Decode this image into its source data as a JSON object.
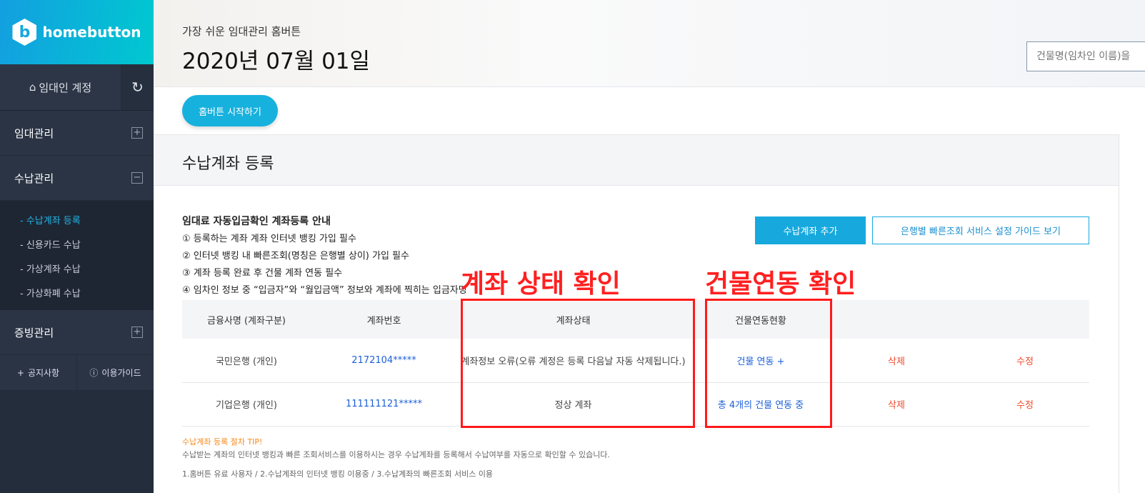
{
  "sidebar": {
    "logo": "homebutton",
    "account": "임대인 계정",
    "menu": [
      {
        "label": "임대관리",
        "toggle": "+"
      },
      {
        "label": "수납관리",
        "toggle": "−"
      },
      {
        "label": "증빙관리",
        "toggle": "+"
      }
    ],
    "sub": [
      "- 수납계좌 등록",
      "- 신용카드 수납",
      "- 가상계좌 수납",
      "- 가상화폐 수납"
    ],
    "notice": "공지사항",
    "guide": "이용가이드"
  },
  "header": {
    "subtitle": "가장 쉬운 임대관리 홈버튼",
    "date": "2020년 07월 01일",
    "search_placeholder": "건물명(임차인 이름)을"
  },
  "start_button": "홈버튼 시작하기",
  "section_title": "수납계좌 등록",
  "guide": {
    "title": "임대료 자동입금확인 계좌등록 안내",
    "items": [
      "① 등록하는 계좌 계좌 인터넷 뱅킹 가입 필수",
      "② 인터넷 뱅킹 내 빠른조회(명칭은 은행별 상이) 가입 필수",
      "③ 계좌 등록 완료 후 건물 계좌 연동 필수",
      "④ 임차인 정보 중 “입금자”와 “월입금액” 정보와 계좌에 찍히는 입금자명"
    ]
  },
  "buttons": {
    "add": "수납계좌 추가",
    "bank_guide": "은행별 빠른조회 서비스 설정 가이드 보기"
  },
  "table": {
    "headers": [
      "금융사명 (계좌구분)",
      "계좌번호",
      "계좌상태",
      "건물연동현황",
      "",
      ""
    ],
    "rows": [
      [
        "국민은행 (개인)",
        "2172104*****",
        "계좌정보 오류(오류 계정은 등록 다음날 자동 삭제됩니다.)",
        "건물 연동 +",
        "삭제",
        "수정"
      ],
      [
        "기업은행 (개인)",
        "111111121*****",
        "정상 계좌",
        "총 4개의 건물 연동 중",
        "삭제",
        "수정"
      ]
    ]
  },
  "annotations": [
    "계좌 상태 확인",
    "건물연동 확인"
  ],
  "tip": {
    "title": "수납계좌 등록 절차 TIP!",
    "text": "수납받는 계좌의 인터넷 뱅킹과 빠른 조회서비스를 이용하시는 경우 수납계좌를 등록해서 수납여부를 자동으로 확인할 수 있습니다.",
    "steps": "1.홈버튼 유료 사용자 / 2.수납계좌의 인터넷 뱅킹 이용중 / 3.수납계좌의 빠른조회 서비스 이용"
  }
}
